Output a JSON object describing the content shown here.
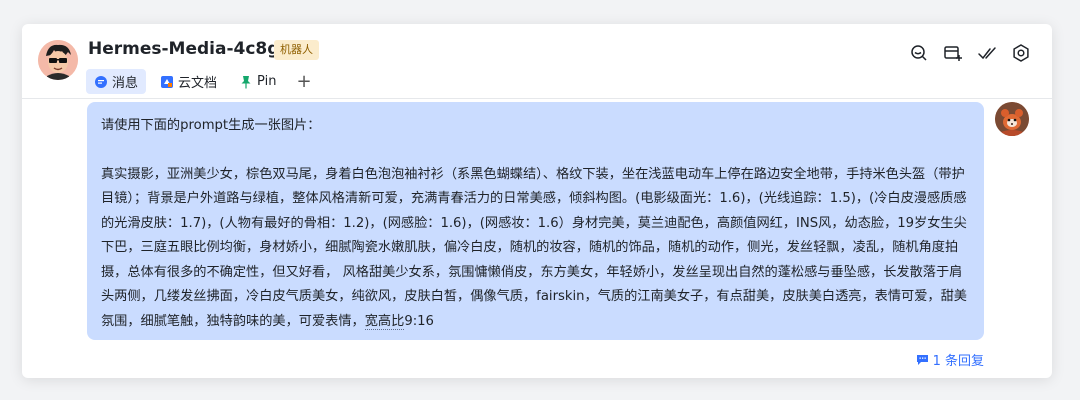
{
  "header": {
    "title": "Hermes-Media-4c8g",
    "badge": "机器人"
  },
  "tabs": [
    {
      "label": "消息",
      "icon": "chat-bubble-icon"
    },
    {
      "label": "云文档",
      "icon": "doc-icon"
    },
    {
      "label": "Pin",
      "icon": "pin-icon"
    }
  ],
  "header_icons": [
    "search-chat-icon",
    "add-tab-icon",
    "check-icon",
    "settings-gear-icon"
  ],
  "message": {
    "intro": "请使用下面的prompt生成一张图片：",
    "body_before": "真实摄影，亚洲美少女，棕色双马尾，身着白色泡泡袖衬衫（系黑色蝴蝶结）、格纹下装，坐在浅蓝电动车上停在路边安全地带，手持米色头盔（带护目镜）；背景是户外道路与绿植，整体风格清新可爱，充满青春活力的日常美感，倾斜构图。(电影级面光：1.6)，(光线追踪：1.5)，(冷白皮漫感质感的光滑皮肤：1.7)，(人物有最好的骨相：1.2)，(网感脸：1.6)，(网感妆：1.6）身材完美，莫兰迪配色，高颜值网红，INS风，幼态脸，19岁女生尖下巴，三庭五眼比例均衡，身材娇小，细腻陶瓷水嫩肌肤，偏冷白皮，随机的妆容，随机的饰品，随机的动作，侧光，发丝轻飘，凌乱，随机角度拍摄，总体有很多的不确定性，但又好看， 风格甜美少女系，氛围慵懒俏皮，东方美女，年轻娇小，发丝呈现出自然的蓬松感与垂坠感，长发散落于肩头两侧，几缕发丝拂面，冷白皮气质美女，纯欲风，皮肤白皙，偶像气质，fairskin，气质的江南美女子，有点甜美，皮肤美白透亮，表情可爱，甜美氛围，细腻笔触，独特韵味的美，可爱表情，",
    "body_dotted": "宽高比",
    "body_after": "9:16"
  },
  "reply": {
    "label": "1 条回复"
  },
  "colors": {
    "accent": "#3370ff",
    "bubble": "#cadcff",
    "badge_bg": "#fbeccc"
  }
}
